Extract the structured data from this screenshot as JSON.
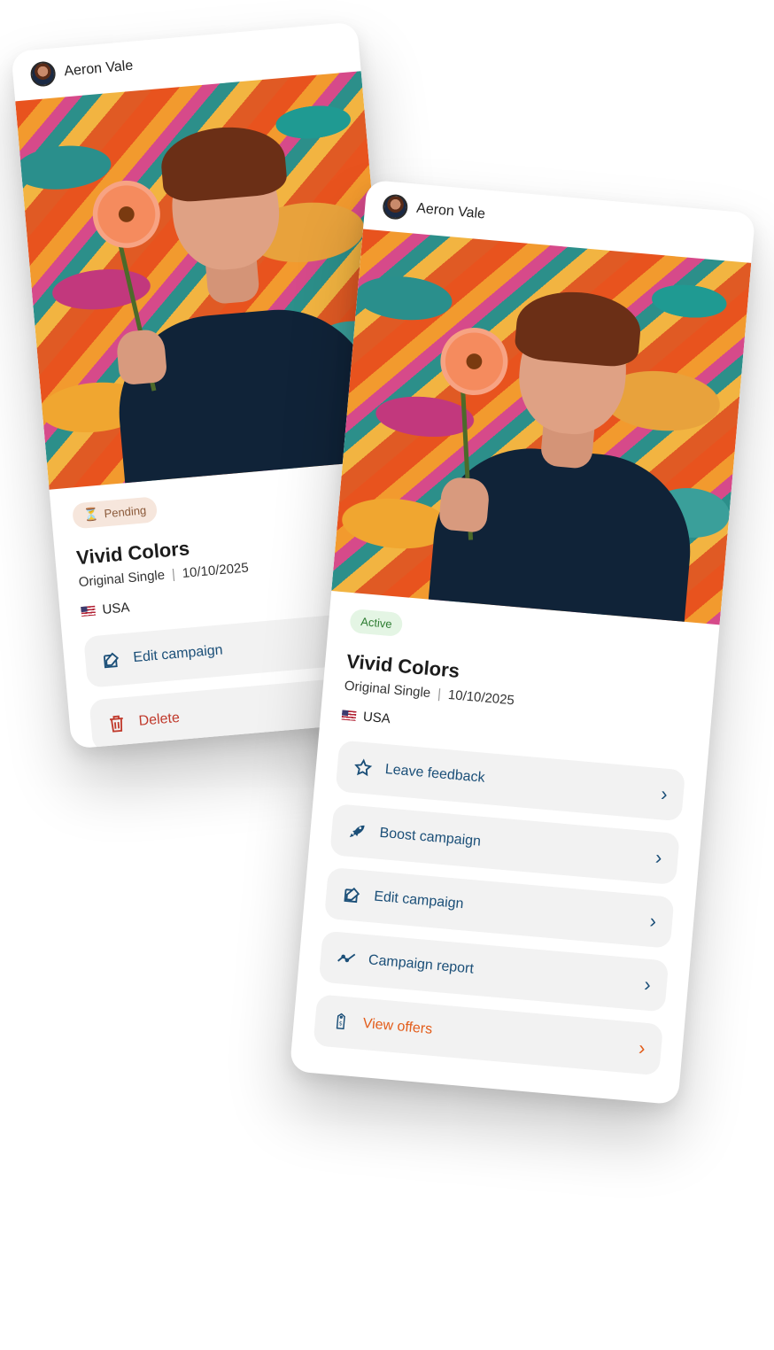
{
  "back_card": {
    "user": {
      "name": "Aeron Vale"
    },
    "status": {
      "label": "Pending",
      "icon": "hourglass-icon",
      "color": "#8b5a3a"
    },
    "title": "Vivid Colors",
    "type": "Original Single",
    "separator": "|",
    "date": "10/10/2025",
    "country": "USA",
    "actions": [
      {
        "label": "Edit campaign",
        "icon": "edit-icon",
        "color": "#1b4f78"
      },
      {
        "label": "Delete",
        "icon": "trash-icon",
        "color": "#c0392b"
      }
    ]
  },
  "front_card": {
    "user": {
      "name": "Aeron Vale"
    },
    "status": {
      "label": "Active",
      "color": "#2e7d32"
    },
    "title": "Vivid Colors",
    "type": "Original Single",
    "separator": "|",
    "date": "10/10/2025",
    "country": "USA",
    "actions": [
      {
        "label": "Leave feedback",
        "icon": "star-icon",
        "color": "#1b4f78"
      },
      {
        "label": "Boost campaign",
        "icon": "rocket-icon",
        "color": "#1b4f78"
      },
      {
        "label": "Edit campaign",
        "icon": "edit-icon",
        "color": "#1b4f78"
      },
      {
        "label": "Campaign report",
        "icon": "trend-line-icon",
        "color": "#1b4f78"
      },
      {
        "label": "View offers",
        "icon": "price-tag-icon",
        "color": "#e35d1b"
      }
    ],
    "chevron": "›"
  }
}
